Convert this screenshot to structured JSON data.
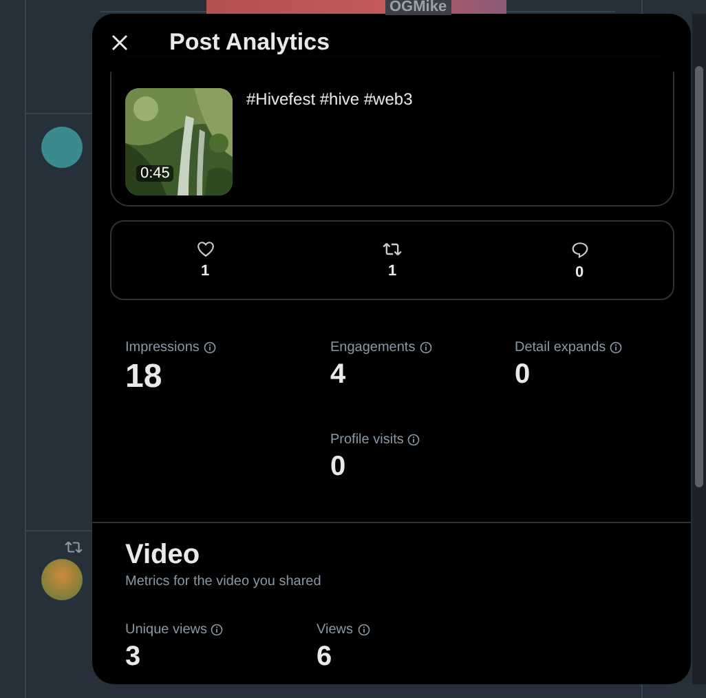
{
  "backdrop": {
    "banner_label": "OGMike"
  },
  "dialog": {
    "title": "Post Analytics"
  },
  "post": {
    "text": "#Hivefest #hive #web3",
    "video_duration": "0:45"
  },
  "engagement_counts": [
    {
      "kind": "like",
      "count": "1"
    },
    {
      "kind": "repost",
      "count": "1"
    },
    {
      "kind": "reply",
      "count": "0"
    }
  ],
  "metrics": [
    {
      "kind": "primary",
      "label": "Impressions",
      "value": "18"
    },
    {
      "kind": "standard",
      "label": "Engagements",
      "value": "4"
    },
    {
      "kind": "standard",
      "label": "Detail expands",
      "value": "0"
    },
    {
      "kind": "standard",
      "label": "Profile visits",
      "value": "0"
    }
  ],
  "video_section": {
    "title": "Video",
    "subtitle": "Metrics for the video you shared",
    "metrics": [
      {
        "label": "Unique views",
        "value": "3"
      },
      {
        "label": "Views",
        "value": "6"
      }
    ]
  }
}
